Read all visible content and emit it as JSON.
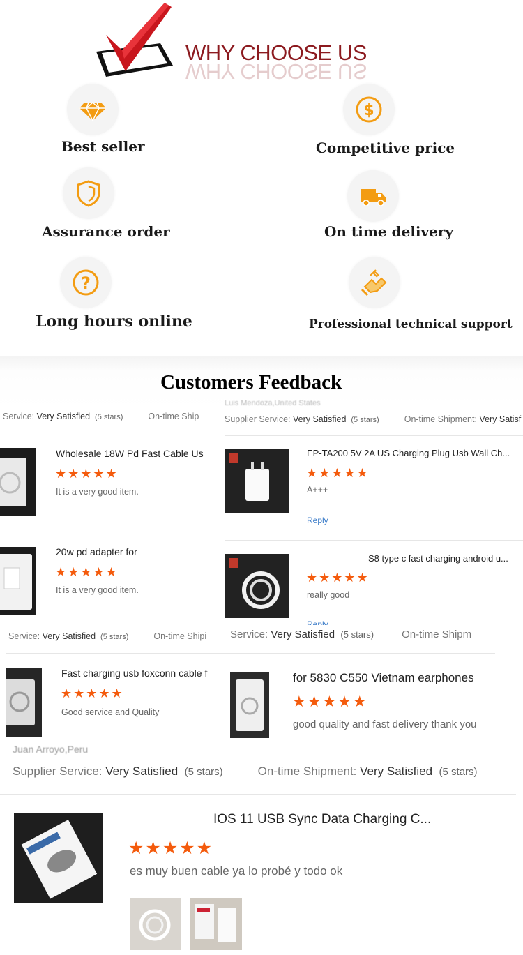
{
  "header": {
    "title": "WHY CHOOSE US",
    "colors": {
      "title": "#8c1a1f",
      "check": "#c8161d",
      "icon": "#f39c12"
    }
  },
  "features": [
    {
      "icon": "diamond-icon",
      "label": "Best seller"
    },
    {
      "icon": "dollar-icon",
      "label": "Competitive price"
    },
    {
      "icon": "shield-icon",
      "label": "Assurance order"
    },
    {
      "icon": "truck-icon",
      "label": "On time delivery"
    },
    {
      "icon": "question-icon",
      "label": "Long hours online"
    },
    {
      "icon": "handshake-icon",
      "label": "Professional technical support"
    }
  ],
  "feedback": {
    "title": "Customers Feedback",
    "service_label": "Supplier Service:",
    "service_label_cut": "Service:",
    "service_value": "Very Satisfied",
    "stars_text": "(5 stars)",
    "ontime_label": "On-time Shipment:",
    "ontime_label_cut1": "On-time Ship",
    "ontime_label_cut2": "On-time Shipi",
    "ontime_label_cut3": "On-time Shipm",
    "ontime_value_cut": "Very Satisf",
    "star_glyphs": "★★★★★",
    "reply": "Reply",
    "reply_cut": "Reply",
    "buyer_top": "Luis Mendoza,United States",
    "buyer_bottom": "Juan Arroyo,Peru",
    "reviews": [
      {
        "product": "Wholesale 18W Pd Fast Cable Us",
        "comment": "It is a very good item."
      },
      {
        "product": "20w pd adapter for",
        "comment": "It is a very good item."
      },
      {
        "product": "EP-TA200 5V 2A US Charging Plug Usb Wall Ch...",
        "comment": "A+++"
      },
      {
        "product": "S8 type c fast charging android u...",
        "comment": "really good"
      },
      {
        "product": "Fast charging usb foxconn cable f",
        "comment": "Good service and Quality"
      },
      {
        "product": "for 5830 C550 Vietnam earphones",
        "comment": "good quality and fast delivery thank you"
      },
      {
        "product": "IOS 11 USB Sync Data Charging C...",
        "comment": "es muy buen cable ya lo probé y todo ok"
      }
    ]
  }
}
